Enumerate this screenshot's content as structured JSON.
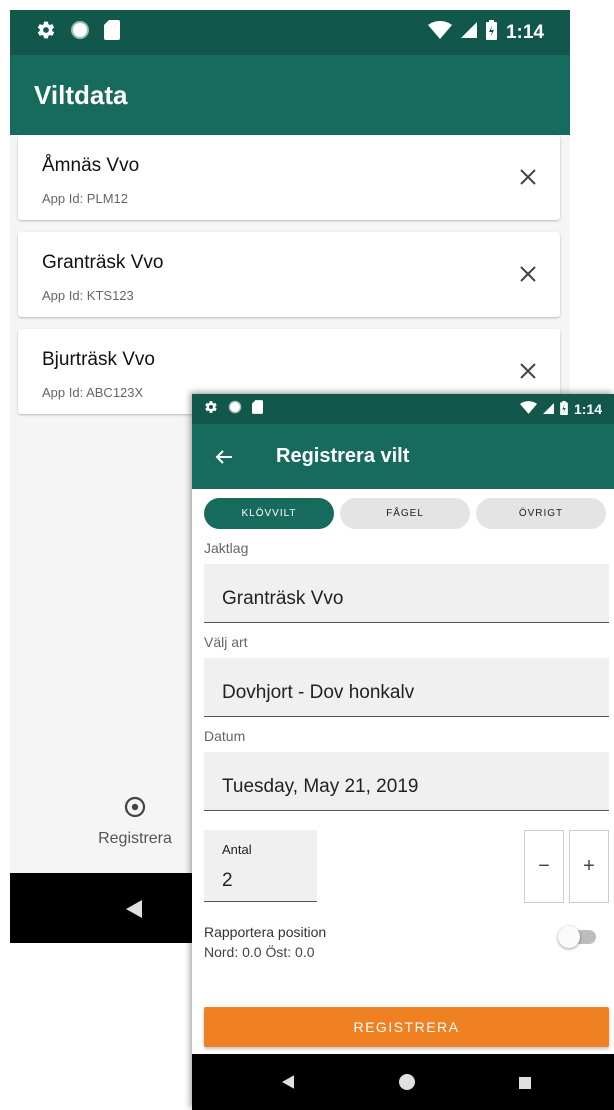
{
  "screen_main": {
    "status_time": "1:14",
    "app_title": "Viltdata",
    "cards": [
      {
        "name": "Åmnäs Vvo",
        "app_id": "App Id: PLM12"
      },
      {
        "name": "Granträsk Vvo",
        "app_id": "App Id: KTS123"
      },
      {
        "name": "Bjurträsk Vvo",
        "app_id": "App Id: ABC123X"
      }
    ],
    "bottom_nav_label": "Registrera"
  },
  "screen_register": {
    "status_time": "1:14",
    "title": "Registrera vilt",
    "tabs": [
      "KLÖVVILT",
      "FÅGEL",
      "ÖVRIGT"
    ],
    "active_tab": "KLÖVVILT",
    "jaktlag_label": "Jaktlag",
    "jaktlag_value": "Granträsk Vvo",
    "art_label": "Välj art",
    "art_value": "Dovhjort - Dov honkalv",
    "datum_label": "Datum",
    "datum_value": "Tuesday, May 21, 2019",
    "antal_label": "Antal",
    "antal_value": "2",
    "minus_label": "−",
    "plus_label": "+",
    "position_label": "Rapportera position",
    "position_coords": "Nord: 0.0 Öst: 0.0",
    "position_enabled": false,
    "submit_label": "REGISTRERA"
  },
  "colors": {
    "status_bar": "#12574b",
    "app_bar": "#166b5c",
    "accent_orange": "#f08122",
    "background": "#f5f5f5"
  }
}
